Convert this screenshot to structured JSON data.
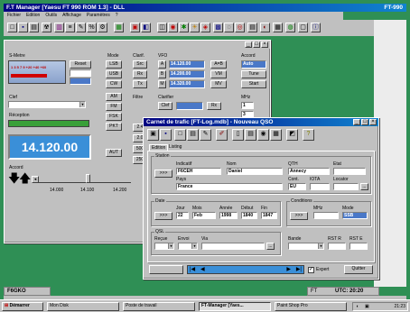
{
  "app": {
    "title": "F.T Manager [Yaesu FT 990 ROM 1.3] - DLL",
    "right_label": "FT-990",
    "menu": [
      "Fichier",
      "Edition",
      "Outils",
      "Affichage",
      "Paramètres",
      "?"
    ]
  },
  "smeter": {
    "label": "S-Metre",
    "scale": "1 3 5 7 9 +20 +40 +60",
    "reset": "Reset",
    "val_fields": [
      "",
      "",
      ""
    ]
  },
  "mode": {
    "label": "Mode",
    "items": [
      "LSB",
      "USB",
      "CW",
      "AM",
      "FM",
      "FSK",
      "PKT"
    ],
    "aut": "AUT"
  },
  "freq": {
    "label_rx": "Réception",
    "label_txt": "Clef",
    "value": "14.120.00",
    "down": "◂",
    "up": "▸",
    "scale": [
      "14.000",
      "14.100",
      "14.200"
    ],
    "accord_label": "Accord"
  },
  "clarif": {
    "label": "Clarif.",
    "items": [
      "Src",
      "Rx",
      "Tx",
      "Clar"
    ]
  },
  "vfo": {
    "label": "VFO",
    "items": [
      "A",
      "B",
      "M"
    ],
    "fields": [
      "14.120.00",
      "14.200.00",
      "14.320.00"
    ],
    "ops": [
      "A=B",
      "VM",
      "MV"
    ]
  },
  "right": {
    "accord_label": "Accord",
    "accord_fields": [
      "Auto",
      "Tune",
      "Start"
    ],
    "mhz_label": "MHz",
    "mhz_fields": [
      "1",
      "3",
      "5"
    ]
  },
  "filter": {
    "label": "Filtre",
    "items": [
      "2.4",
      "2.0",
      "500",
      "250"
    ]
  },
  "clear": {
    "label": "Clarifier",
    "items": [
      "Clef",
      "Rx",
      "Tx",
      "Aff"
    ]
  },
  "log": {
    "title": "Carnet de trafic [FT-Log.mdb] - Nouveau QSO",
    "tabs": [
      "Edition",
      "Listing"
    ],
    "station_label": "Station",
    "indicatif_l": "Indicatif",
    "indicatif": "F6CEH",
    "nom_l": "Nom",
    "nom": "Daniel",
    "qth_l": "QTH",
    "qth": "Annecy",
    "etat_l": "Etat",
    "etat": "",
    "pays_l": "Pays",
    "pays": "France",
    "cont_l": "Cont.",
    "cont": "EU",
    "iota_l": "IOTA",
    "iota": "",
    "locator_l": "Locator",
    "locator": "",
    "date_label": "Date",
    "jour_l": "Jour",
    "jour": "22",
    "mois_l": "Mois",
    "mois": "Feb",
    "annee_l": "Année",
    "annee": "1998",
    "debut_l": "Début",
    "debut": "1840",
    "fin_l": "Fin",
    "fin": "1847",
    "cond_label": "Conditions",
    "mhz_l": "MHz",
    "mhz": "",
    "mode_l": "Mode",
    "mode": "SSB",
    "qsl_label": "QSL",
    "recue_l": "Reçue",
    "envoi_l": "Envoi",
    "via_l": "Via",
    "bande_l": "Bande",
    "rstr_l": "RST R",
    "rste_l": "RST E",
    "btn": ">>>",
    "expert": "Expert",
    "quitter": "Quitter"
  },
  "taskbar": {
    "start": "Démarrer",
    "items": [
      "Mon Disk",
      "Poste de travail",
      "FT-Manager [Yaes...",
      "Paint Shop Pro"
    ],
    "tray": "UTC: 20:20",
    "clock": "21:23",
    "top_left": "F6GKO",
    "tray_mid": "FT"
  }
}
